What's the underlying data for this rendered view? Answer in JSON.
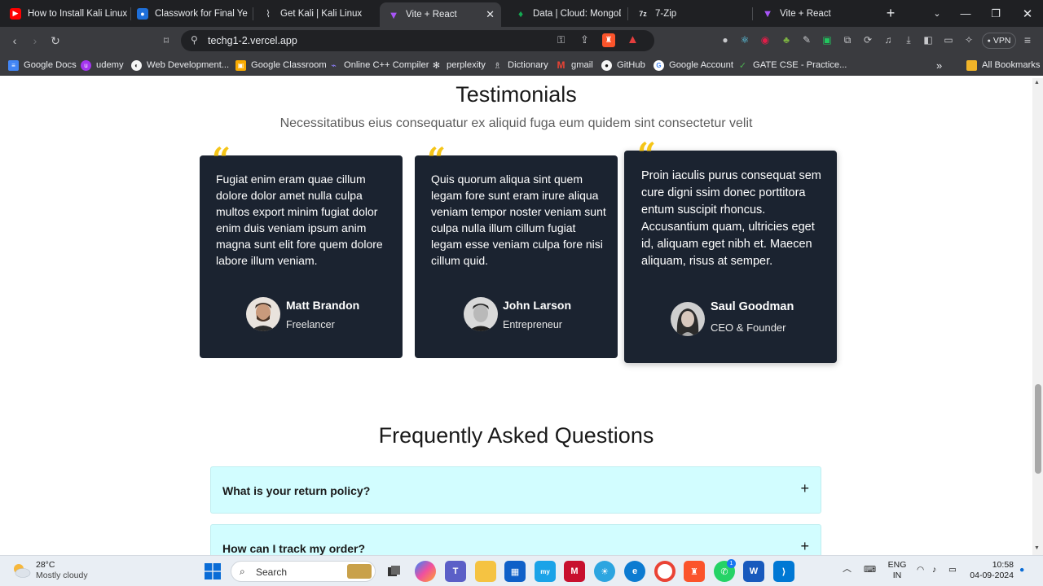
{
  "browser": {
    "tabs": [
      {
        "title": "How to Install Kali Linux",
        "icon": "youtube-icon",
        "color": "#ff0000"
      },
      {
        "title": "Classwork for Final Year C",
        "icon": "classroom-icon",
        "color": "#1e6fd9"
      },
      {
        "title": "Get Kali | Kali Linux",
        "icon": "kali-icon",
        "color": "#cfd2d6"
      },
      {
        "title": "Vite + React",
        "icon": "vite-icon",
        "color": "#a855f7",
        "active": true
      },
      {
        "title": "Data | Cloud: MongoDB C",
        "icon": "mongodb-icon",
        "color": "#13aa52"
      },
      {
        "title": "7-Zip",
        "icon": "7zip-icon",
        "color": "#e8eaed"
      },
      {
        "title": "Vite + React",
        "icon": "vite-icon",
        "color": "#a855f7"
      }
    ],
    "url": "techg1-2.vercel.app",
    "vpn_label": "VPN",
    "bookmarks": [
      {
        "label": "Google Docs",
        "icon": "docs-icon",
        "color": "#4285f4"
      },
      {
        "label": "udemy",
        "icon": "udemy-icon",
        "color": "#a435f0"
      },
      {
        "label": "Web Development...",
        "icon": "webdev-icon",
        "color": "#222"
      },
      {
        "label": "Google Classroom",
        "icon": "classroom-icon",
        "color": "#f9ab00"
      },
      {
        "label": "Online C++ Compiler",
        "icon": "compiler-icon",
        "color": "#6a5acd"
      },
      {
        "label": "perplexity",
        "icon": "perplexity-icon",
        "color": "#333"
      },
      {
        "label": "Dictionary",
        "icon": "dictionary-icon",
        "color": "#666"
      },
      {
        "label": "gmail",
        "icon": "gmail-icon",
        "color": "#ea4335"
      },
      {
        "label": "GitHub",
        "icon": "github-icon",
        "color": "#222"
      },
      {
        "label": "Google Account",
        "icon": "google-icon",
        "color": "#fff"
      },
      {
        "label": "GATE CSE - Practice...",
        "icon": "gate-icon",
        "color": "#2e7d32"
      }
    ],
    "all_bookmarks_label": "All Bookmarks"
  },
  "testimonials": {
    "title": "Testimonials",
    "subtitle": "Necessitatibus eius consequatur ex aliquid fuga eum quidem sint consectetur velit",
    "cards": [
      {
        "text": "Fugiat enim eram quae cillum dolore dolor amet nulla culpa multos export minim fugiat dolor enim duis veniam ipsum anim magna sunt elit fore quem dolore labore illum veniam.",
        "name": "Matt Brandon",
        "role": "Freelancer"
      },
      {
        "text": "Quis quorum aliqua sint quem legam fore sunt eram irure aliqua veniam tempor noster veniam sunt culpa nulla illum cillum fugiat legam esse veniam culpa fore nisi cillum quid.",
        "name": "John Larson",
        "role": "Entrepreneur"
      },
      {
        "text": "Proin iaculis purus consequat sem cure digni ssim donec porttitora entum suscipit rhoncus. Accusantium quam, ultricies eget id, aliquam eget nibh et. Maecen aliquam, risus at semper.",
        "name": "Saul Goodman",
        "role": "CEO & Founder"
      }
    ]
  },
  "faq": {
    "title": "Frequently Asked Questions",
    "items": [
      {
        "question": "What is your return policy?"
      },
      {
        "question": "How can I track my order?"
      }
    ]
  },
  "taskbar": {
    "weather_temp": "28°C",
    "weather_desc": "Mostly cloudy",
    "search_label": "Search",
    "lang_line1": "ENG",
    "lang_line2": "IN",
    "time": "10:58",
    "date": "04-09-2024",
    "whatsapp_badge": "1"
  }
}
